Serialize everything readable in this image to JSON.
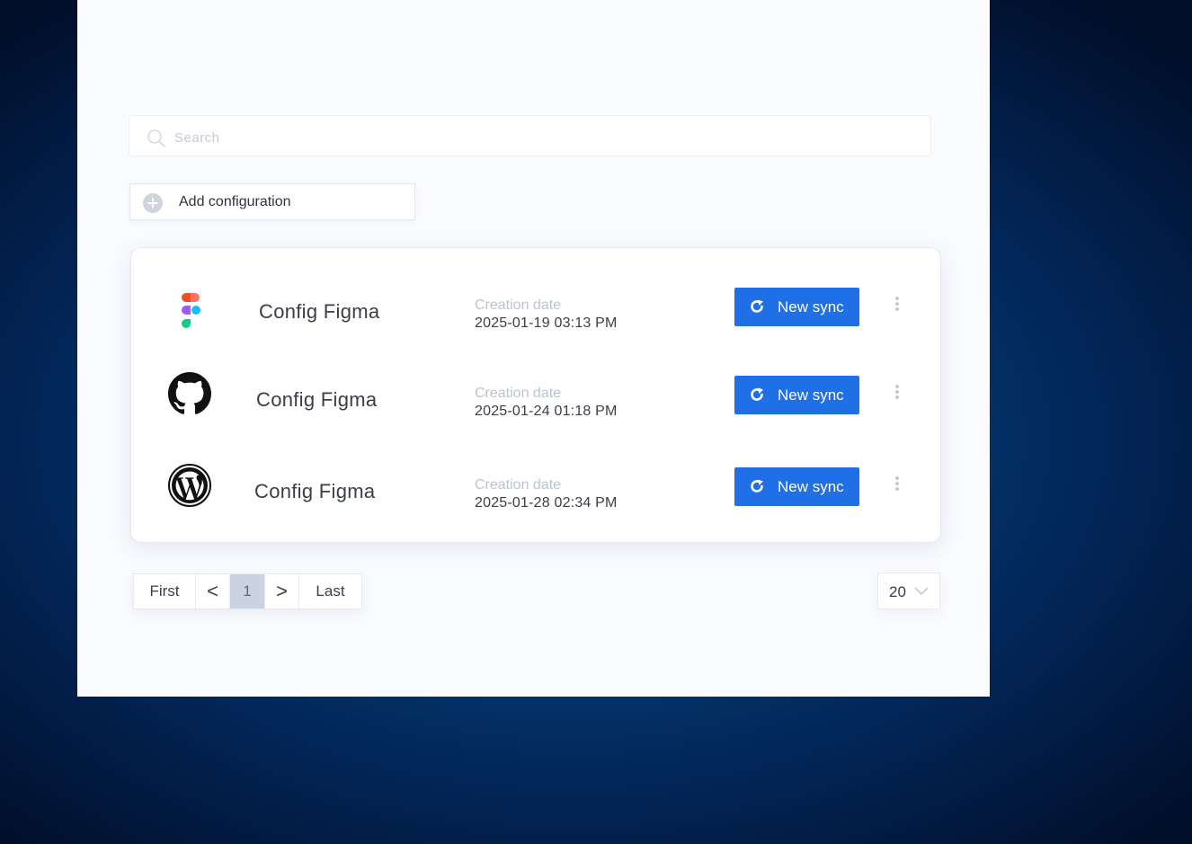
{
  "search": {
    "placeholder": "Search"
  },
  "add_button": {
    "label": "Add configuration"
  },
  "configs": [
    {
      "name": "Config Figma",
      "date_label": "Creation date",
      "date": "2025-01-19 03:13 PM",
      "icon": "figma-logo-icon",
      "action": "New sync"
    },
    {
      "name": "Config Figma",
      "date_label": "Creation date",
      "date": "2025-01-24 01:18 PM",
      "icon": "github-logo-icon",
      "action": "New sync"
    },
    {
      "name": "Config Figma",
      "date_label": "Creation date",
      "date": "2025-01-28 02:34 PM",
      "icon": "wordpress-logo-icon",
      "action": "New sync"
    }
  ],
  "pagination": {
    "first": "First",
    "prev": "<",
    "current": "1",
    "next": ">",
    "last": "Last"
  },
  "per_page": {
    "value": "20"
  },
  "colors": {
    "accent": "#1f6fe6",
    "active_page": "#c9d3e2",
    "muted_text": "#bcc3d0"
  }
}
